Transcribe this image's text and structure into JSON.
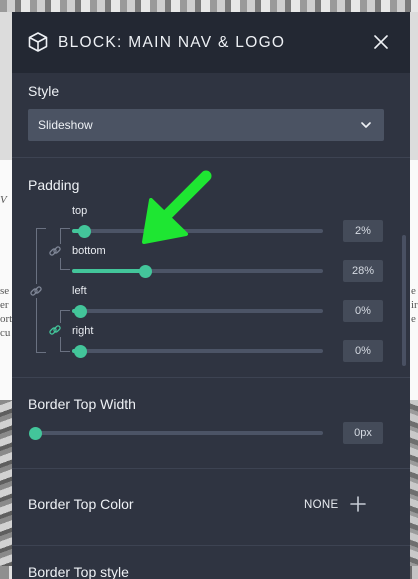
{
  "header": {
    "title": "BLOCK: MAIN NAV & LOGO",
    "icon": "cube-icon",
    "close_icon": "close-icon"
  },
  "style": {
    "label": "Style",
    "selected": "Slideshow"
  },
  "padding": {
    "label": "Padding",
    "sliders": [
      {
        "label": "top",
        "value": 2,
        "display": "2%"
      },
      {
        "label": "bottom",
        "value": 28,
        "display": "28%"
      },
      {
        "label": "left",
        "value": 0,
        "display": "0%"
      },
      {
        "label": "right",
        "value": 0,
        "display": "0%"
      }
    ]
  },
  "border_top_width": {
    "label": "Border Top Width",
    "value": 0,
    "display": "0px"
  },
  "border_top_color": {
    "label": "Border Top Color",
    "value": "NONE"
  },
  "border_top_style": {
    "label": "Border Top style"
  },
  "colors": {
    "accent": "#43c59a",
    "panel": "#2f3441",
    "header": "#232833",
    "annotation_arrow": "#1ee632"
  },
  "background": {
    "left_text": [
      "V",
      "se",
      "er",
      "ort",
      "cu"
    ],
    "right_text": [
      "e",
      "ir",
      "e"
    ]
  }
}
